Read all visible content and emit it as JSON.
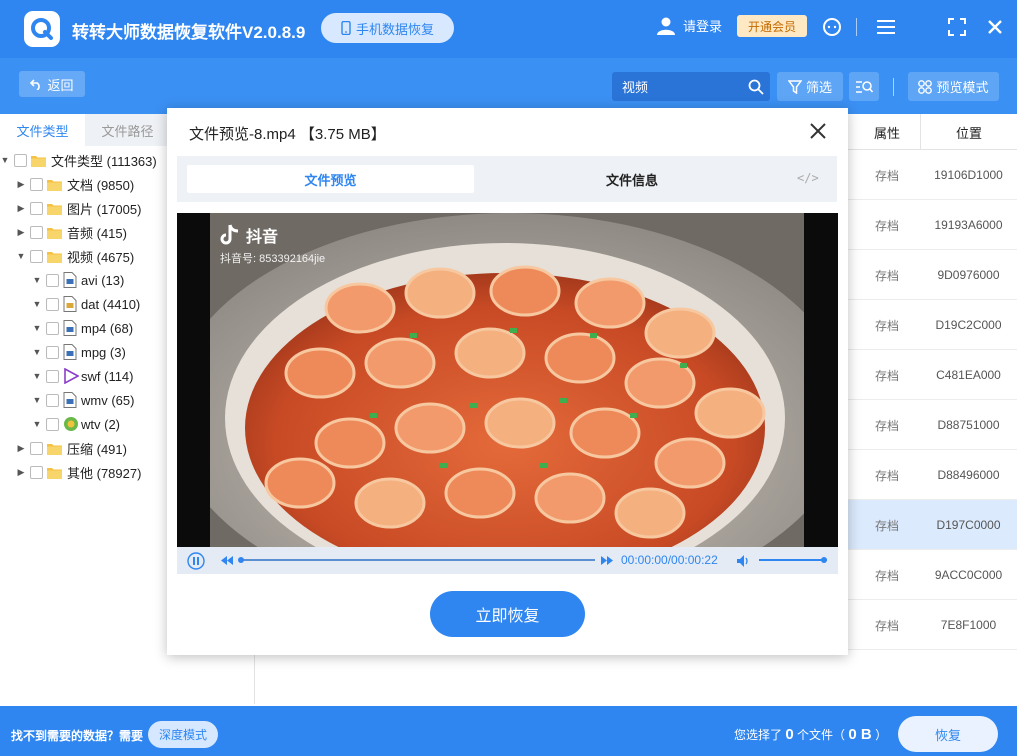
{
  "app": {
    "title": "转转大师数据恢复软件V2.0.8.9",
    "mobile_button": "手机数据恢复",
    "login": "请登录",
    "vip_button": "开通会员"
  },
  "toolbar": {
    "back": "返回",
    "search_value": "视频",
    "filter": "筛选",
    "preview_mode": "预览模式"
  },
  "left_tabs": [
    "文件类型",
    "文件路径"
  ],
  "tree": [
    {
      "label": "文件类型 (111363)",
      "level": 0
    },
    {
      "label": "文档 (9850)",
      "level": 1
    },
    {
      "label": "图片 (17005)",
      "level": 1
    },
    {
      "label": "音频 (415)",
      "level": 1
    },
    {
      "label": "视频 (4675)",
      "level": 1
    },
    {
      "label": "avi (13)",
      "level": 2
    },
    {
      "label": "dat (4410)",
      "level": 2
    },
    {
      "label": "mp4 (68)",
      "level": 2
    },
    {
      "label": "mpg (3)",
      "level": 2
    },
    {
      "label": "swf (114)",
      "level": 2
    },
    {
      "label": "wmv (65)",
      "level": 2
    },
    {
      "label": "wtv (2)",
      "level": 2
    },
    {
      "label": "压缩 (491)",
      "level": 1
    },
    {
      "label": "其他 (78927)",
      "level": 1
    }
  ],
  "table": {
    "headers": {
      "attr": "属性",
      "pos": "位置"
    },
    "rows": [
      {
        "attr": "存档",
        "pos": "19106D1000"
      },
      {
        "attr": "存档",
        "pos": "19193A6000"
      },
      {
        "attr": "存档",
        "pos": "9D0976000"
      },
      {
        "attr": "存档",
        "pos": "D19C2C000"
      },
      {
        "attr": "存档",
        "pos": "C481EA000"
      },
      {
        "attr": "存档",
        "pos": "D88751000"
      },
      {
        "attr": "存档",
        "pos": "D88496000"
      },
      {
        "attr": "存档",
        "pos": "D197C0000"
      },
      {
        "attr": "存档",
        "pos": "9ACC0C000"
      },
      {
        "attr": "存档",
        "pos": "7E8F1000"
      }
    ],
    "selected_row": 7
  },
  "modal": {
    "title": "文件预览-8.mp4 【3.75 MB】",
    "tab_preview": "文件预览",
    "tab_info": "文件信息",
    "code_icon": "</>",
    "watermark_brand": "抖音",
    "watermark_id": "抖音号: 853392164jie",
    "time": "00:00:00/00:00:22",
    "progress": 0,
    "volume": 1,
    "recover_button": "立即恢复"
  },
  "footer": {
    "tip": "找不到需要的数据？需要",
    "deep_mode": "深度模式",
    "sel_prefix": "您选择了",
    "sel_count": "0",
    "sel_mid": "个文件（",
    "sel_size": "0 B",
    "sel_suffix": "）",
    "recover": "恢复"
  },
  "colors": {
    "brand": "#2f86f0",
    "selected_row": "#dbeafd"
  }
}
